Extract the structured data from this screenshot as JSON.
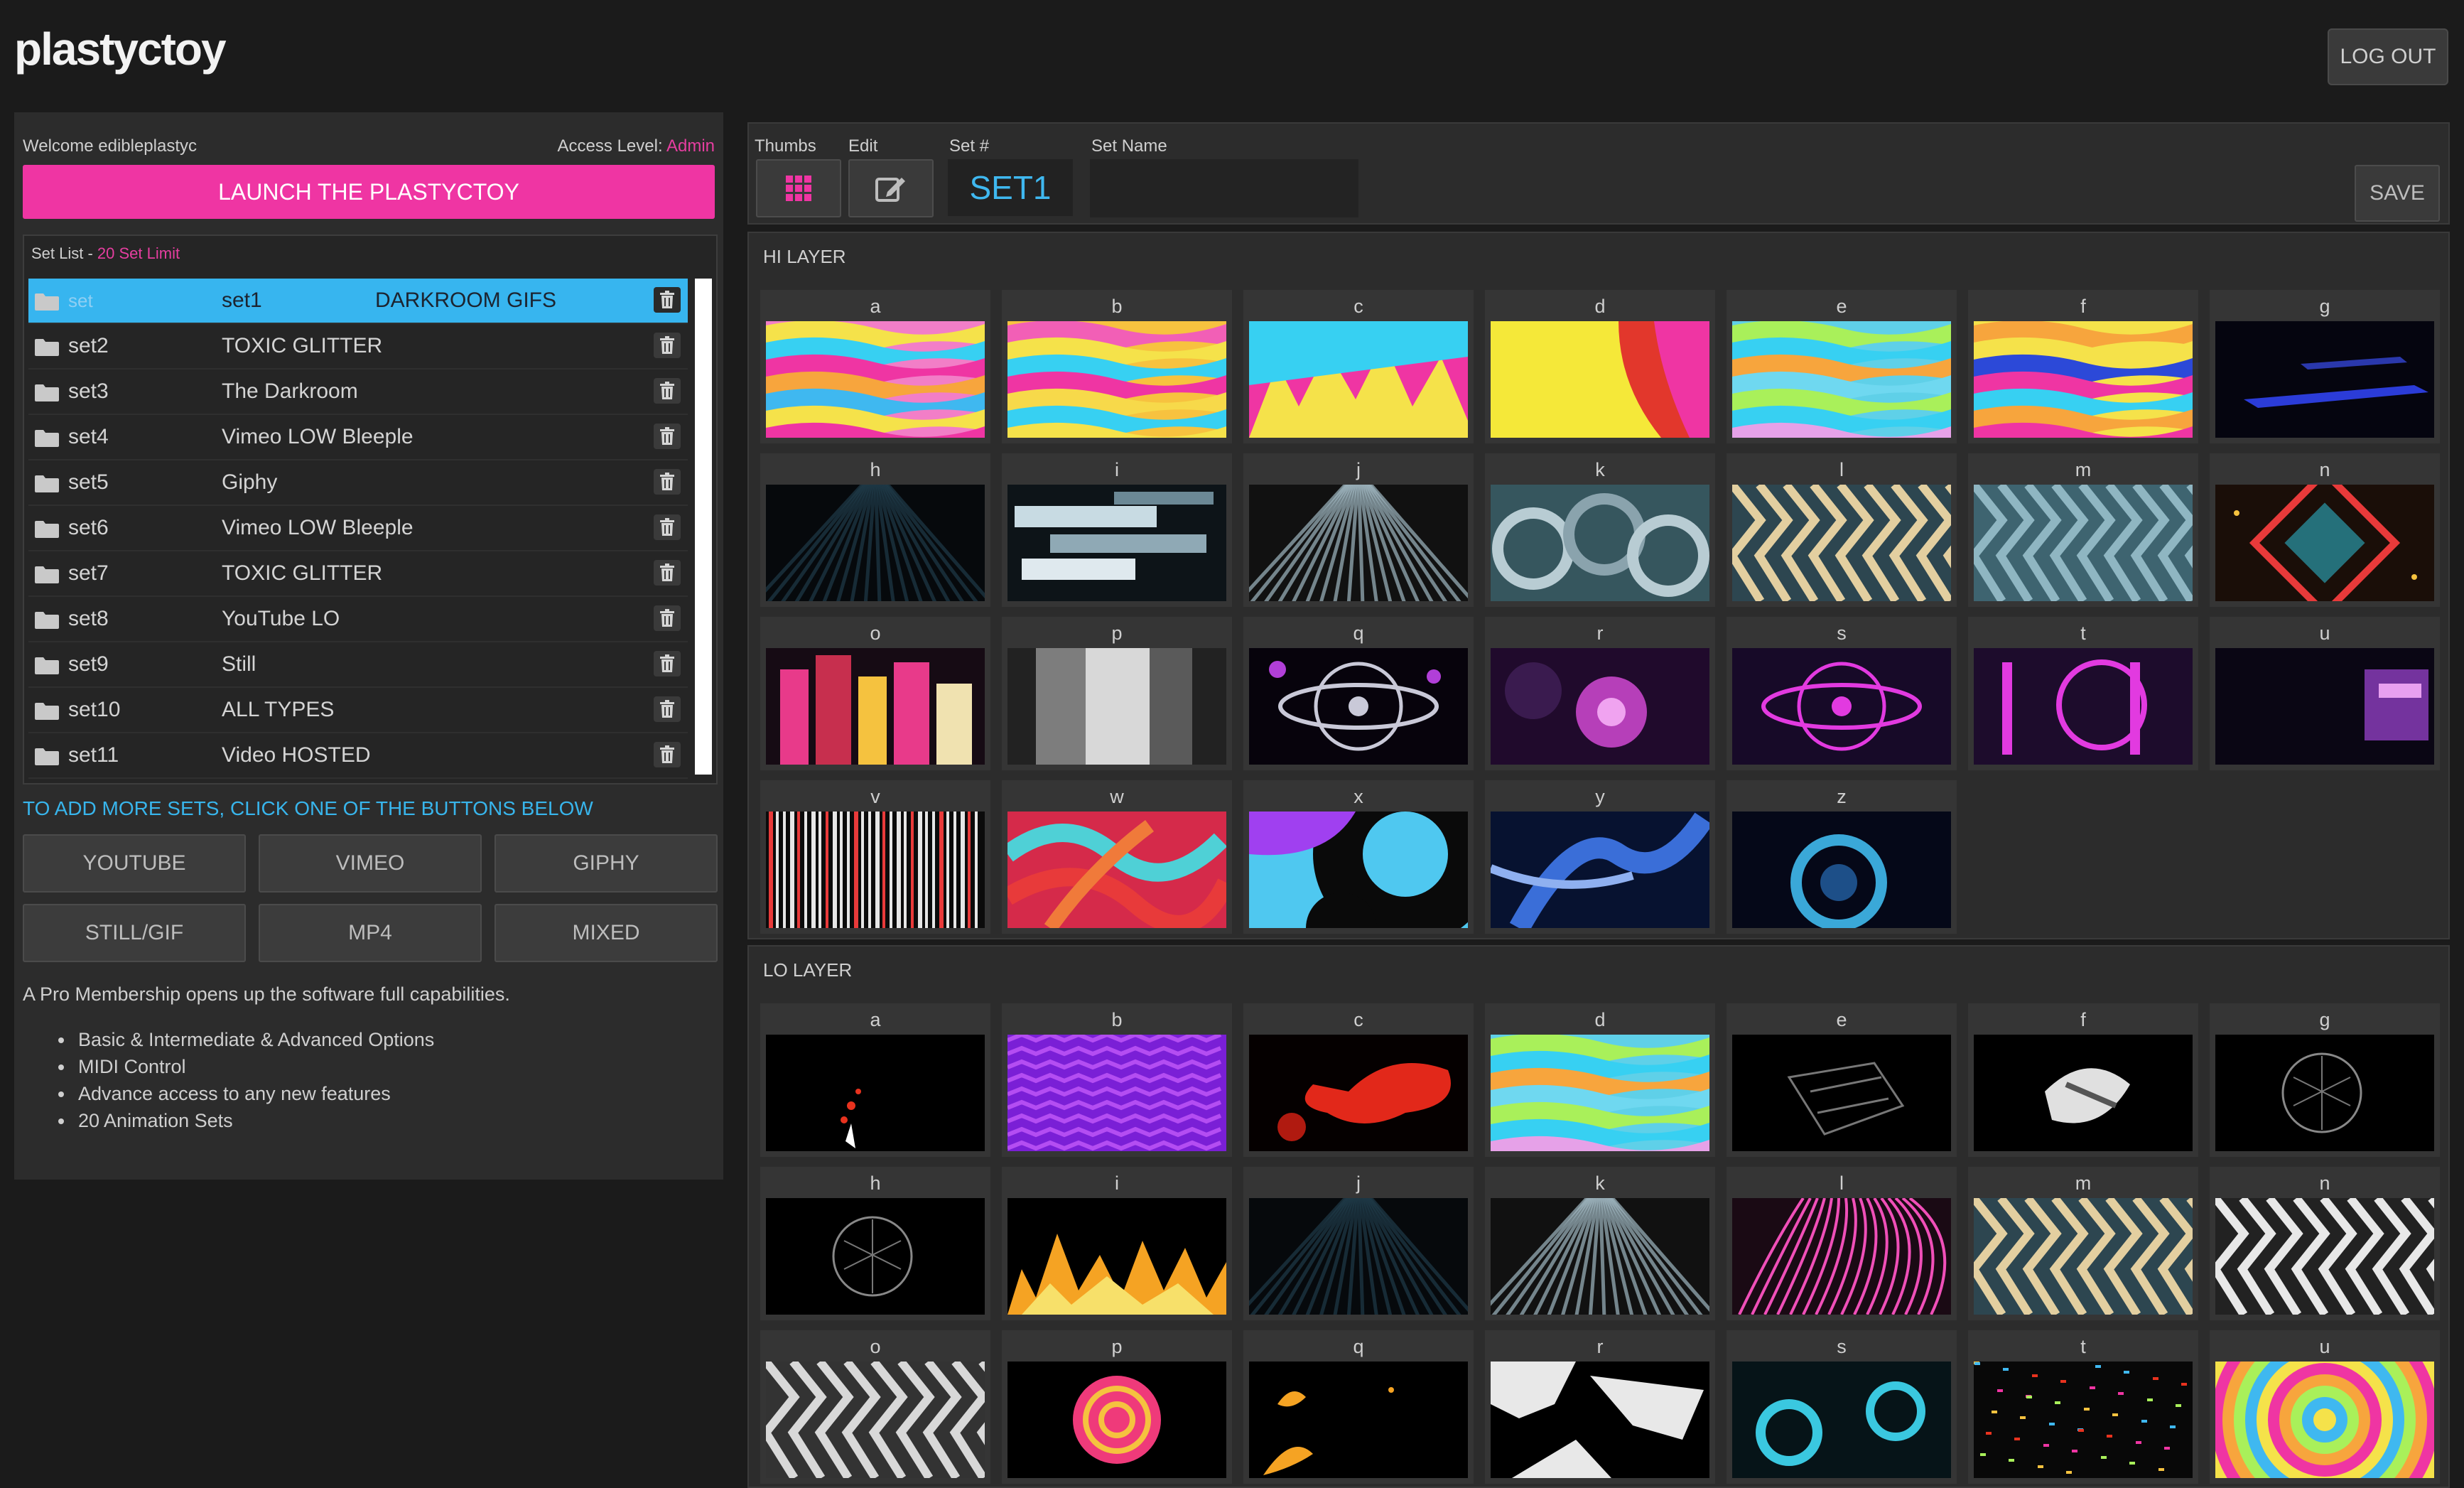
{
  "app": {
    "logo": "plastyctoy",
    "logout_label": "LOG OUT"
  },
  "sidebar": {
    "welcome": "Welcome edibleplastyc",
    "access_label": "Access Level: ",
    "access_level": "Admin",
    "launch_label": "LAUNCH THE PLASTYCTOY",
    "setlist_label": "Set List - ",
    "setlist_limit": "20 Set Limit",
    "sets": [
      {
        "id": "set1",
        "name": "DARKROOM GIFS",
        "selected": true,
        "ghost": "set"
      },
      {
        "id": "set2",
        "name": "TOXIC GLITTER"
      },
      {
        "id": "set3",
        "name": "The Darkroom"
      },
      {
        "id": "set4",
        "name": "Vimeo LOW Bleeple"
      },
      {
        "id": "set5",
        "name": "Giphy"
      },
      {
        "id": "set6",
        "name": "Vimeo LOW Bleeple"
      },
      {
        "id": "set7",
        "name": "TOXIC GLITTER"
      },
      {
        "id": "set8",
        "name": "YouTube LO"
      },
      {
        "id": "set9",
        "name": "Still"
      },
      {
        "id": "set10",
        "name": "ALL TYPES"
      },
      {
        "id": "set11",
        "name": "Video HOSTED"
      }
    ],
    "add_sets_msg": "TO ADD MORE SETS, CLICK ONE OF THE BUTTONS BELOW",
    "source_buttons": [
      "YOUTUBE",
      "VIMEO",
      "GIPHY",
      "STILL/GIF",
      "MP4",
      "MIXED"
    ],
    "pro_text": "A Pro Membership opens up the software full capabilities.",
    "features": [
      "Basic & Intermediate & Advanced Options",
      "MIDI Control",
      "Advance access to any new features",
      "20 Animation Sets"
    ]
  },
  "toolbar": {
    "thumbs_label": "Thumbs",
    "edit_label": "Edit",
    "setnum_label": "Set #",
    "setnum_value": "SET1",
    "setname_label": "Set Name",
    "setname_value": "",
    "save_label": "SAVE"
  },
  "hi_layer": {
    "title": "HI LAYER",
    "cells": [
      "a",
      "b",
      "c",
      "d",
      "e",
      "f",
      "g",
      "h",
      "i",
      "j",
      "k",
      "l",
      "m",
      "n",
      "o",
      "p",
      "q",
      "r",
      "s",
      "t",
      "u",
      "v",
      "w",
      "x",
      "y",
      "z"
    ]
  },
  "lo_layer": {
    "title": "LO LAYER",
    "cells": [
      "a",
      "b",
      "c",
      "d",
      "e",
      "f",
      "g",
      "h",
      "i",
      "j",
      "k",
      "l",
      "m",
      "n",
      "o",
      "p",
      "q",
      "r",
      "s",
      "t",
      "u"
    ]
  },
  "colors": {
    "accent_pink": "#ef35a3",
    "accent_blue": "#38b5ec",
    "panel": "#2c2c2c",
    "background": "#1b1b1b"
  },
  "icons": {
    "folder": "folder-icon",
    "trash": "trash-icon",
    "thumbs": "grid-icon",
    "edit": "edit-icon"
  }
}
